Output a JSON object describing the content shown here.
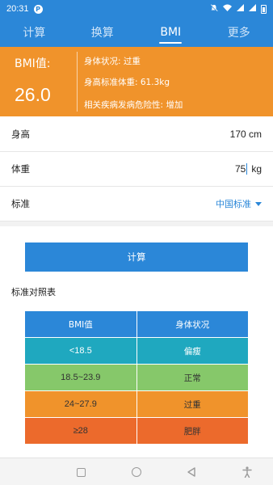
{
  "status_bar": {
    "time": "20:31",
    "app_icon": "P",
    "icons": [
      "mute-icon",
      "wifi-icon",
      "signal-icon",
      "signal-icon",
      "battery-icon"
    ]
  },
  "tabs": [
    {
      "label": "计算",
      "active": false
    },
    {
      "label": "换算",
      "active": false
    },
    {
      "label": "BMI",
      "active": true
    },
    {
      "label": "更多",
      "active": false
    }
  ],
  "result": {
    "bmi_label": "BMI值:",
    "bmi_value": "26.0",
    "status": "身体状况: 过重",
    "standard_weight": "身高标准体重: 61.3kg",
    "risk": "相关疾病发病危险性: 增加",
    "card_color": "#f0932b"
  },
  "form": {
    "height_label": "身高",
    "height_value": "170 cm",
    "weight_label": "体重",
    "weight_value": "75",
    "weight_unit": "kg",
    "standard_label": "标准",
    "standard_value": "中国标准"
  },
  "calc_button": "计算",
  "table": {
    "title": "标准对照表",
    "headers": [
      "BMI值",
      "身体状况"
    ],
    "rows": [
      {
        "range": "<18.5",
        "status": "偏瘦",
        "color": "#1fa8bf"
      },
      {
        "range": "18.5~23.9",
        "status": "正常",
        "color": "#86c86a"
      },
      {
        "range": "24~27.9",
        "status": "过重",
        "color": "#f0932b"
      },
      {
        "range": "≥28",
        "status": "肥胖",
        "color": "#ec6a2c"
      }
    ]
  },
  "nav_bar": {
    "icons": [
      "recents-icon",
      "home-icon",
      "back-icon",
      "accessibility-icon"
    ]
  },
  "colors": {
    "primary": "#2b87d8",
    "orange": "#f0932b"
  }
}
